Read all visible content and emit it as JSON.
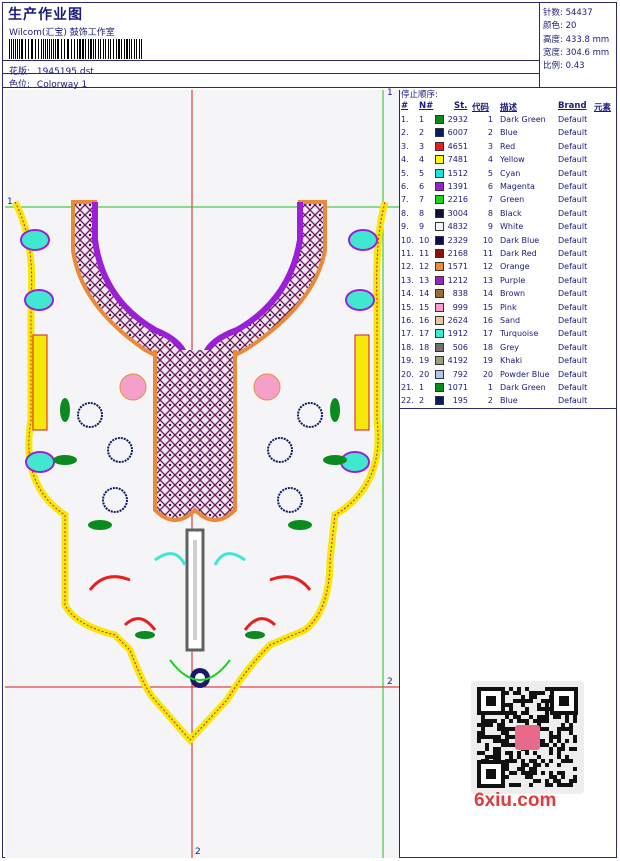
{
  "header": {
    "title": "生产作业图",
    "subtitle": "Wilcom(汇宝) 鼓饰工作室",
    "pattern_label": "花版:",
    "pattern_value": "1945195.dst",
    "colorway_label": "色位:",
    "colorway_value": "Colorway 1"
  },
  "stats": [
    {
      "label": "针数:",
      "value": "54437"
    },
    {
      "label": "颜色:",
      "value": "20"
    },
    {
      "label": "高度:",
      "value": "433.8 mm"
    },
    {
      "label": "宽度:",
      "value": "304.6 mm"
    },
    {
      "label": "比例:",
      "value": "0.43"
    }
  ],
  "stop_table": {
    "title": "停止顺序:",
    "headers": {
      "num": "#",
      "n": "N#",
      "st": "St.",
      "code": "代码",
      "desc": "描述",
      "brand": "Brand",
      "elem": "元素"
    },
    "rows": [
      {
        "num": "1.",
        "n": "1",
        "color": "#0b8a1f",
        "st": "2932",
        "code": "1",
        "desc": "Dark Green",
        "brand": "Default"
      },
      {
        "num": "2.",
        "n": "2",
        "color": "#0a1a66",
        "st": "6007",
        "code": "2",
        "desc": "Blue",
        "brand": "Default"
      },
      {
        "num": "3.",
        "n": "3",
        "color": "#e81f1f",
        "st": "4651",
        "code": "3",
        "desc": "Red",
        "brand": "Default"
      },
      {
        "num": "4.",
        "n": "4",
        "color": "#ffff00",
        "st": "7481",
        "code": "4",
        "desc": "Yellow",
        "brand": "Default"
      },
      {
        "num": "5.",
        "n": "5",
        "color": "#20e0e0",
        "st": "1512",
        "code": "5",
        "desc": "Cyan",
        "brand": "Default"
      },
      {
        "num": "6.",
        "n": "6",
        "color": "#9a1fd6",
        "st": "1391",
        "code": "6",
        "desc": "Magenta",
        "brand": "Default"
      },
      {
        "num": "7.",
        "n": "7",
        "color": "#1ed21e",
        "st": "2216",
        "code": "7",
        "desc": "Green",
        "brand": "Default"
      },
      {
        "num": "8.",
        "n": "8",
        "color": "#101030",
        "st": "3004",
        "code": "8",
        "desc": "Black",
        "brand": "Default"
      },
      {
        "num": "9.",
        "n": "9",
        "color": "#f4f4f4",
        "st": "4832",
        "code": "9",
        "desc": "White",
        "brand": "Default"
      },
      {
        "num": "10.",
        "n": "10",
        "color": "#0a0a55",
        "st": "2329",
        "code": "10",
        "desc": "Dark Blue",
        "brand": "Default"
      },
      {
        "num": "11.",
        "n": "11",
        "color": "#8a1010",
        "st": "2168",
        "code": "11",
        "desc": "Dark Red",
        "brand": "Default"
      },
      {
        "num": "12.",
        "n": "12",
        "color": "#f08a3a",
        "st": "1571",
        "code": "12",
        "desc": "Orange",
        "brand": "Default"
      },
      {
        "num": "13.",
        "n": "13",
        "color": "#a020c0",
        "st": "1212",
        "code": "13",
        "desc": "Purple",
        "brand": "Default"
      },
      {
        "num": "14.",
        "n": "14",
        "color": "#9a6a3a",
        "st": "838",
        "code": "14",
        "desc": "Brown",
        "brand": "Default"
      },
      {
        "num": "15.",
        "n": "15",
        "color": "#f4a0c8",
        "st": "999",
        "code": "15",
        "desc": "Pink",
        "brand": "Default"
      },
      {
        "num": "16.",
        "n": "16",
        "color": "#e8c89a",
        "st": "2624",
        "code": "16",
        "desc": "Sand",
        "brand": "Default"
      },
      {
        "num": "17.",
        "n": "17",
        "color": "#40e8d0",
        "st": "1912",
        "code": "17",
        "desc": "Turquoise",
        "brand": "Default"
      },
      {
        "num": "18.",
        "n": "18",
        "color": "#707070",
        "st": "506",
        "code": "18",
        "desc": "Grey",
        "brand": "Default"
      },
      {
        "num": "19.",
        "n": "19",
        "color": "#a0a080",
        "st": "4192",
        "code": "19",
        "desc": "Khaki",
        "brand": "Default"
      },
      {
        "num": "20.",
        "n": "20",
        "color": "#b0c8e8",
        "st": "792",
        "code": "20",
        "desc": "Powder Blue",
        "brand": "Default"
      },
      {
        "num": "21.",
        "n": "1",
        "color": "#0b8a1f",
        "st": "1071",
        "code": "1",
        "desc": "Dark Green",
        "brand": "Default"
      },
      {
        "num": "22.",
        "n": "2",
        "color": "#0a1a66",
        "st": "195",
        "code": "2",
        "desc": "Blue",
        "brand": "Default"
      }
    ]
  },
  "canvas": {
    "marker_1_top": "1",
    "marker_1_left": "1",
    "marker_2_right": "2",
    "marker_2_bottom": "2"
  },
  "watermark": "6xiu.com"
}
